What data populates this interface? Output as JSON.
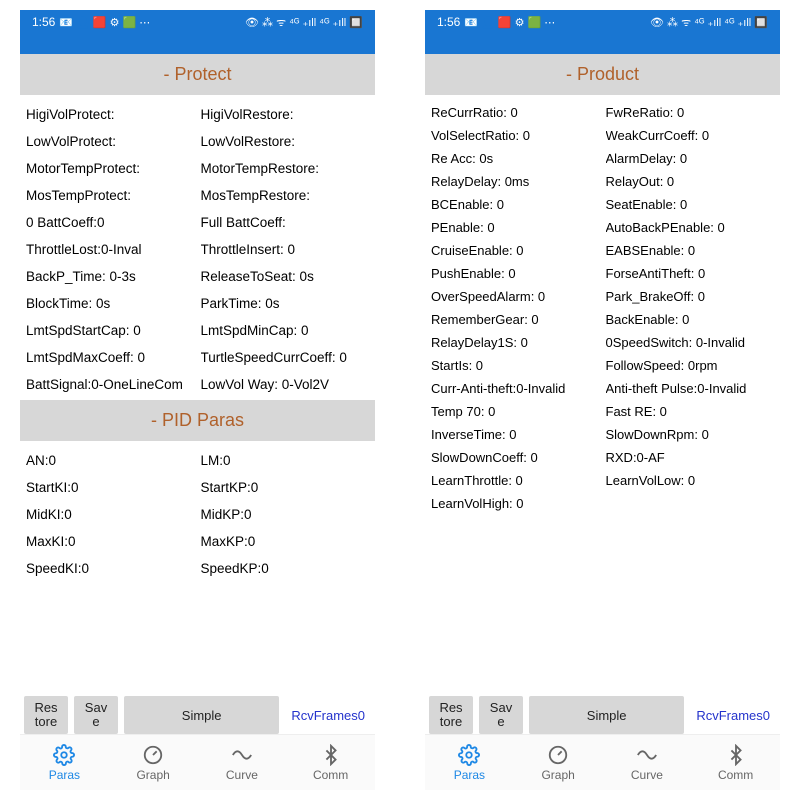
{
  "statusbar": {
    "time": "1:56",
    "left_icons": "📧 👤 🟥 ⚙ 🟩 ⋯",
    "right_icons": "👁 ⁂ ᯤ ⁴ᴳ ₊ıll ⁴ᴳ ₊ıll 🔲"
  },
  "screen_left": {
    "sections": [
      {
        "title": "- Protect",
        "rows": [
          [
            "HigiVolProtect:",
            "HigiVolRestore:"
          ],
          [
            "LowVolProtect:",
            "LowVolRestore:"
          ],
          [
            "MotorTempProtect:",
            "MotorTempRestore:"
          ],
          [
            "MosTempProtect:",
            "MosTempRestore:"
          ],
          [
            "0 BattCoeff:0",
            "Full BattCoeff:"
          ],
          [
            "ThrottleLost:0-Inval",
            "ThrottleInsert:   0"
          ],
          [
            "BackP_Time: 0-3s",
            "ReleaseToSeat:   0s"
          ],
          [
            "BlockTime:   0s",
            "ParkTime:   0s"
          ],
          [
            "LmtSpdStartCap:   0",
            "LmtSpdMinCap:   0"
          ],
          [
            "LmtSpdMaxCoeff:   0",
            "TurtleSpeedCurrCoeff:   0"
          ],
          [
            "BattSignal:0-OneLineCom",
            "LowVol Way: 0-Vol2V"
          ]
        ]
      },
      {
        "title": "- PID Paras",
        "rows": [
          [
            "AN:0",
            "LM:0"
          ],
          [
            "StartKI:0",
            "StartKP:0"
          ],
          [
            "MidKI:0",
            "MidKP:0"
          ],
          [
            "MaxKI:0",
            "MaxKP:0"
          ],
          [
            "SpeedKI:0",
            "SpeedKP:0"
          ]
        ]
      }
    ]
  },
  "screen_right": {
    "sections": [
      {
        "title": "- Product",
        "rows": [
          [
            "ReCurrRatio:   0",
            "FwReRatio:   0"
          ],
          [
            "VolSelectRatio:   0",
            "WeakCurrCoeff:   0"
          ],
          [
            "Re Acc:   0s",
            "AlarmDelay:   0"
          ],
          [
            "RelayDelay:   0ms",
            "RelayOut:   0"
          ],
          [
            "BCEnable:   0",
            "SeatEnable:   0"
          ],
          [
            "PEnable:   0",
            "AutoBackPEnable:   0"
          ],
          [
            "CruiseEnable:   0",
            "EABSEnable:   0"
          ],
          [
            "PushEnable:   0",
            "ForseAntiTheft:   0"
          ],
          [
            "OverSpeedAlarm:   0",
            "Park_BrakeOff:   0"
          ],
          [
            "RememberGear:   0",
            "BackEnable:   0"
          ],
          [
            "RelayDelay1S:   0",
            "0SpeedSwitch: 0-Invalid"
          ],
          [
            "StartIs:   0",
            "FollowSpeed:   0rpm"
          ],
          [
            "Curr-Anti-theft:0-Invalid",
            "Anti-theft Pulse:0-Invalid"
          ],
          [
            "Temp 70: 0",
            "Fast RE: 0"
          ],
          [
            "InverseTime:   0",
            "SlowDownRpm:   0"
          ],
          [
            "SlowDownCoeff:   0",
            "RXD:0-AF"
          ],
          [
            "LearnThrottle:   0",
            "LearnVolLow:   0"
          ],
          [
            "LearnVolHigh:   0",
            ""
          ]
        ]
      }
    ]
  },
  "footer": {
    "restore": "Res\ntore",
    "save": "Sav\ne",
    "simple": "Simple",
    "rcv": "RcvFrames0"
  },
  "nav": {
    "paras": "Paras",
    "graph": "Graph",
    "curve": "Curve",
    "comm": "Comm"
  }
}
